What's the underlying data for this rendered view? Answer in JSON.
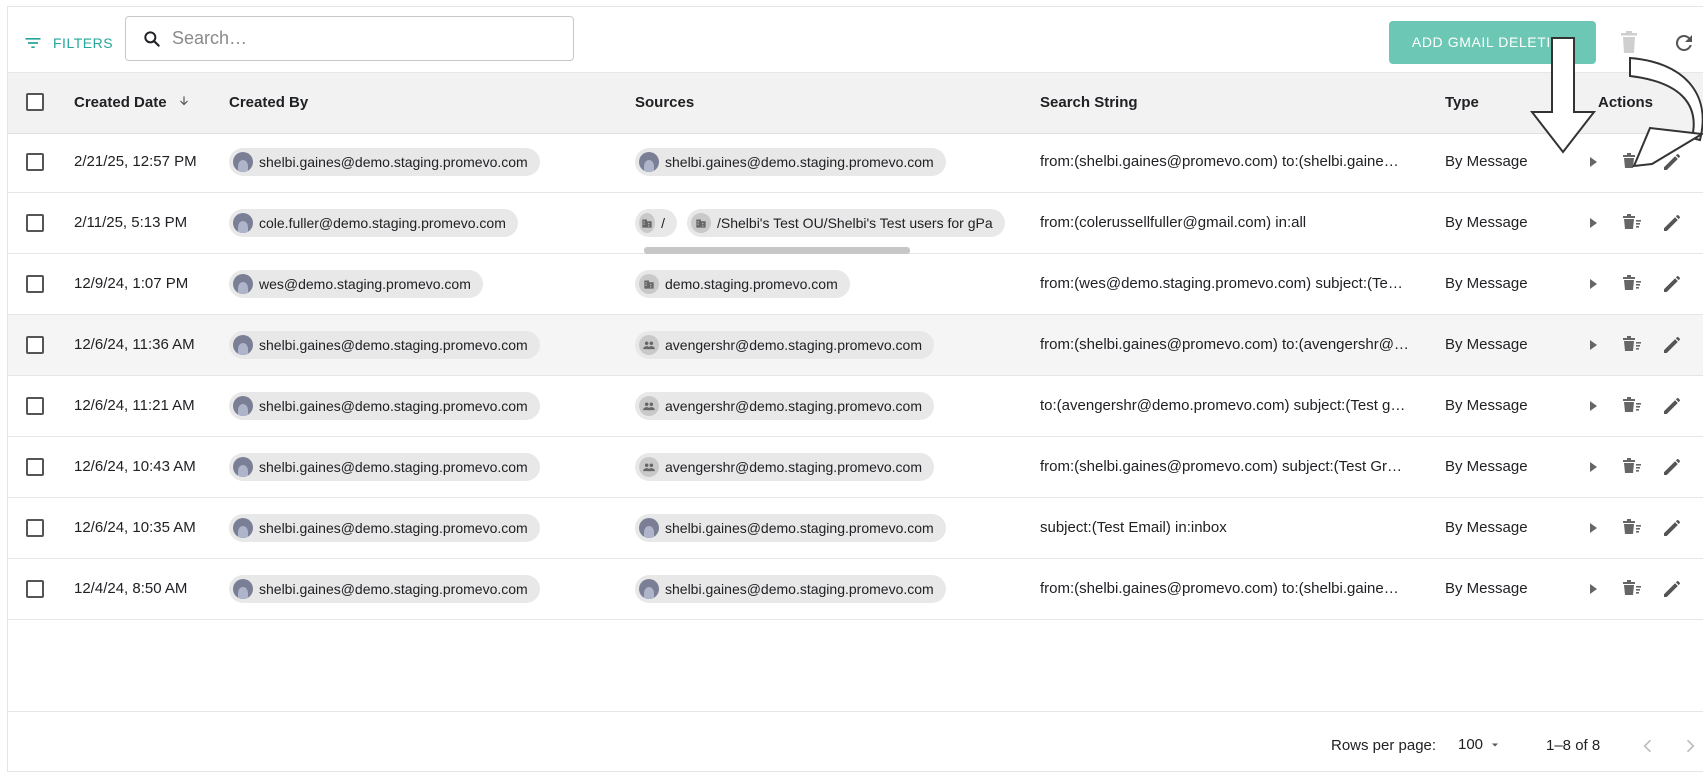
{
  "toolbar": {
    "filters_label": "FILTERS",
    "search_placeholder": "Search…",
    "add_button_label": "ADD GMAIL DELETION",
    "accent_color": "#26a69a",
    "button_color": "#6cc7b5"
  },
  "table": {
    "columns": [
      "Created Date",
      "Created By",
      "Sources",
      "Search String",
      "Type",
      "Actions"
    ],
    "sort_column": "Created Date",
    "sort_direction": "descending",
    "rows": [
      {
        "date": "2/21/25, 12:57 PM",
        "created_by": "shelbi.gaines@demo.staging.promevo.com",
        "sources": [
          {
            "kind": "user",
            "label": "shelbi.gaines@demo.staging.promevo.com"
          }
        ],
        "search": "from:(shelbi.gaines@promevo.com) to:(shelbi.gaine…",
        "type": "By Message"
      },
      {
        "date": "2/11/25, 5:13 PM",
        "created_by": "cole.fuller@demo.staging.promevo.com",
        "sources": [
          {
            "kind": "org",
            "label": "/"
          },
          {
            "kind": "org",
            "label": "/Shelbi's Test OU/Shelbi's Test users for gPa"
          }
        ],
        "search": "from:(colerussellfuller@gmail.com) in:all",
        "type": "By Message"
      },
      {
        "date": "12/9/24, 1:07 PM",
        "created_by": "wes@demo.staging.promevo.com",
        "sources": [
          {
            "kind": "org",
            "label": "demo.staging.promevo.com"
          }
        ],
        "search": "from:(wes@demo.staging.promevo.com) subject:(Te…",
        "type": "By Message"
      },
      {
        "date": "12/6/24, 11:36 AM",
        "created_by": "shelbi.gaines@demo.staging.promevo.com",
        "sources": [
          {
            "kind": "group",
            "label": "avengershr@demo.staging.promevo.com"
          }
        ],
        "search": "from:(shelbi.gaines@promevo.com) to:(avengershr@…",
        "type": "By Message"
      },
      {
        "date": "12/6/24, 11:21 AM",
        "created_by": "shelbi.gaines@demo.staging.promevo.com",
        "sources": [
          {
            "kind": "group",
            "label": "avengershr@demo.staging.promevo.com"
          }
        ],
        "search": "to:(avengershr@demo.promevo.com) subject:(Test g…",
        "type": "By Message"
      },
      {
        "date": "12/6/24, 10:43 AM",
        "created_by": "shelbi.gaines@demo.staging.promevo.com",
        "sources": [
          {
            "kind": "group",
            "label": "avengershr@demo.staging.promevo.com"
          }
        ],
        "search": "from:(shelbi.gaines@promevo.com) subject:(Test Gr…",
        "type": "By Message"
      },
      {
        "date": "12/6/24, 10:35 AM",
        "created_by": "shelbi.gaines@demo.staging.promevo.com",
        "sources": [
          {
            "kind": "user",
            "label": "shelbi.gaines@demo.staging.promevo.com"
          }
        ],
        "search": "subject:(Test Email) in:inbox",
        "type": "By Message"
      },
      {
        "date": "12/4/24, 8:50 AM",
        "created_by": "shelbi.gaines@demo.staging.promevo.com",
        "sources": [
          {
            "kind": "user",
            "label": "shelbi.gaines@demo.staging.promevo.com"
          }
        ],
        "search": "from:(shelbi.gaines@promevo.com) to:(shelbi.gaine…",
        "type": "By Message"
      }
    ],
    "row_icons": [
      "play-icon",
      "delete-sweep-icon",
      "edit-icon"
    ]
  },
  "footer": {
    "rows_per_page_label": "Rows per page:",
    "rows_per_page_value": "100",
    "range_text": "1–8 of 8"
  }
}
